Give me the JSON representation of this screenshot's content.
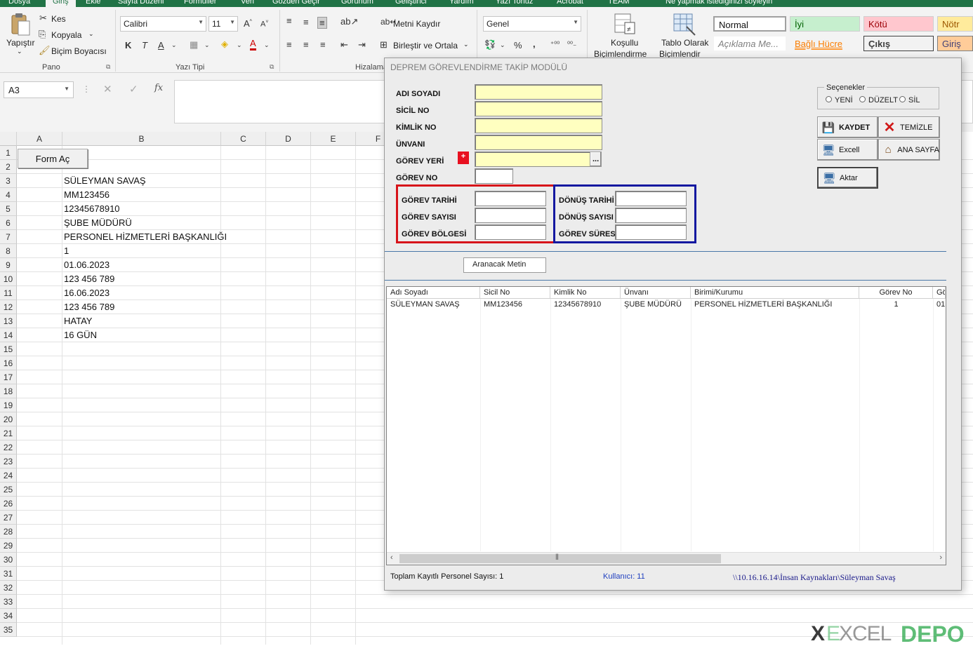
{
  "ribbon": {
    "tabs": [
      "Dosya",
      "Giriş",
      "Ekle",
      "Sayfa Düzeni",
      "Formüller",
      "Veri",
      "Gözden Geçir",
      "Görünüm",
      "Geliştirici",
      "Yardım",
      "Yazı Tonuz",
      "Acrobat",
      "TEAM",
      "Ne yapmak istediğinizi söyleyin"
    ],
    "clipboard": {
      "paste_label": "Yapıştır",
      "cut_label": "Kes",
      "copy_label": "Kopyala",
      "format_painter_label": "Biçim Boyacısı",
      "group_label": "Pano"
    },
    "font": {
      "font_name": "Calibri",
      "font_size": "11",
      "bold_label": "K",
      "italic_label": "T",
      "underline_label": "A",
      "font_color_label": "A",
      "group_label": "Yazı Tipi"
    },
    "alignment": {
      "wrap_text_label": "Metni Kaydır",
      "merge_center_label": "Birleştir ve Ortala",
      "group_label": "Hizalama"
    },
    "number": {
      "format": "Genel",
      "percent": "%",
      "comma": ","
    },
    "styles": {
      "conditional_label_1": "Koşullu",
      "conditional_label_2": "Biçimlendirme",
      "table_label_1": "Tablo Olarak",
      "table_label_2": "Biçimlendir",
      "normal": "Normal",
      "iyi": "İyi",
      "kotu": "Kötü",
      "notr": "Nötr",
      "aciklama": "Açıklama Me...",
      "bagli_hucre": "Bağlı Hücre",
      "cikis": "Çıkış",
      "giris": "Giriş"
    }
  },
  "formula_bar": {
    "name_box": "A3",
    "fx": "fx",
    "formula": ""
  },
  "sheet": {
    "columns": [
      "A",
      "B",
      "C",
      "D",
      "E",
      "F"
    ],
    "rows": [
      "1",
      "2",
      "3",
      "4",
      "5",
      "6",
      "7",
      "8",
      "9",
      "10",
      "11",
      "12",
      "13",
      "14",
      "15",
      "16",
      "17",
      "18",
      "19",
      "20",
      "21",
      "22",
      "23",
      "24",
      "25",
      "26",
      "27",
      "28",
      "29",
      "30",
      "31",
      "32",
      "33",
      "34",
      "35"
    ],
    "form_button": "Form Aç",
    "b_values": [
      "SÜLEYMAN SAVAŞ",
      "MM123456",
      "12345678910",
      "ŞUBE MÜDÜRÜ",
      "PERSONEL HİZMETLERİ BAŞKANLIĞI",
      "1",
      "01.06.2023",
      "123 456 789",
      "16.06.2023",
      "123 456 789",
      "HATAY",
      "16 GÜN"
    ]
  },
  "userform": {
    "title": "DEPREM GÖREVLENDİRME TAKİP MODÜLÜ",
    "labels": {
      "adi_soyadi": "ADI SOYADI",
      "sicil_no": "SİCİL NO",
      "kimlik_no": "KİMLİK NO",
      "unvani": "ÜNVANI",
      "gorev_yeri": "GÖREV YERİ",
      "gorev_no": "GÖREV NO",
      "gorev_tarihi": "GÖREV TARİHİ",
      "gorev_sayisi": "GÖREV SAYISI",
      "gorev_bolgesi": "GÖREV BÖLGESİ",
      "donus_tarihi": "DÖNÜŞ TARİHİ",
      "donus_sayisi": "DÖNÜŞ SAYISI",
      "gorev_suresi": "GÖREV SÜRESİ"
    },
    "add_button": "+",
    "browse_button": "...",
    "options": {
      "title": "Seçenekler",
      "yeni": "YENİ",
      "duzelt": "DÜZELT",
      "sil": "SİL"
    },
    "buttons": {
      "kaydet": "KAYDET",
      "temizle": "TEMİZLE",
      "excell": "Excell",
      "ana_sayfa": "ANA SAYFA",
      "aktar": "Aktar"
    },
    "search_label": "Aranacak Metin",
    "list": {
      "headers": [
        "Adı Soyadı",
        "Sicil No",
        "Kimlik No",
        "Ünvanı",
        "Birimi/Kurumu",
        "Görev No",
        "Gö"
      ],
      "rows": [
        [
          "SÜLEYMAN SAVAŞ",
          "MM123456",
          "12345678910",
          "ŞUBE MÜDÜRÜ",
          "PERSONEL HİZMETLERİ BAŞKANLIĞI",
          "1",
          "01"
        ]
      ]
    },
    "status": {
      "total": "Toplam Kayıtlı Personel Sayısı: 1",
      "user": "Kullanıcı: 11",
      "path": "\\\\10.16.16.14\\İnsan Kaynakları\\Süleyman Savaş"
    },
    "colors": {
      "frame_red": "#d7141a",
      "frame_blue": "#1418a0",
      "input_yellow": "#ffffc0",
      "user_color": "#1f3fbf",
      "path_color": "#1a1a8a"
    }
  },
  "watermark": "EXCELDEPO"
}
